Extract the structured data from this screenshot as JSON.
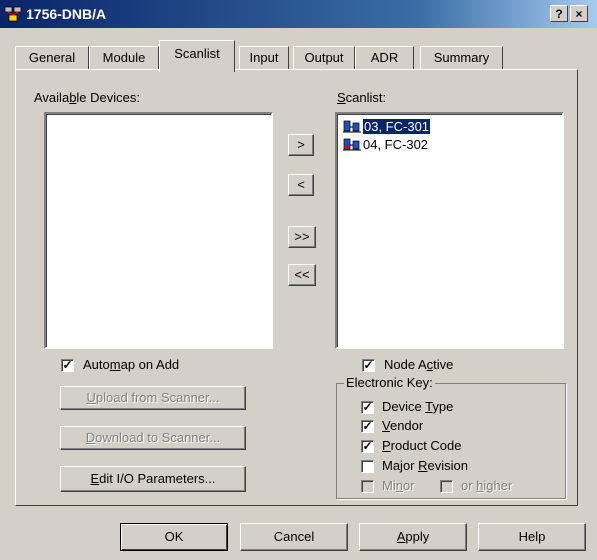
{
  "window": {
    "title": "1756-DNB/A",
    "help_label": "?",
    "close_label": "×"
  },
  "tabs": [
    "General",
    "Module",
    "Scanlist",
    "Input",
    "Output",
    "ADR",
    "Summary"
  ],
  "active_tab": "Scanlist",
  "available_devices": {
    "label_pre": "Availa",
    "label_u": "b",
    "label_post": "le Devices:",
    "items": []
  },
  "scanlist": {
    "label_u": "S",
    "label_post": "canlist:",
    "items": [
      {
        "label": "03, FC-301",
        "selected": true
      },
      {
        "label": "04, FC-302",
        "selected": false
      }
    ]
  },
  "transfer_buttons": {
    "add_one": ">",
    "remove_one": "<",
    "add_all": ">>",
    "remove_all": "<<"
  },
  "automap": {
    "pre": "Auto",
    "u": "m",
    "post": "ap on Add",
    "checked": true
  },
  "upload": {
    "u": "U",
    "post": "pload from Scanner..."
  },
  "download": {
    "u": "D",
    "post": "ownload to Scanner..."
  },
  "edit_io": {
    "u": "E",
    "post": "dit I/O Parameters..."
  },
  "node_active": {
    "pre": "Node A",
    "u": "c",
    "post": "tive",
    "checked": true
  },
  "electronic_key": {
    "title": "Electronic Key:",
    "device_type": {
      "pre": "Device ",
      "u": "T",
      "post": "ype",
      "checked": true
    },
    "vendor": {
      "u": "V",
      "post": "endor",
      "checked": true
    },
    "product_code": {
      "u": "P",
      "post": "roduct Code",
      "checked": true
    },
    "major_revision": {
      "pre": "Major ",
      "u": "R",
      "post": "evision",
      "checked": false
    },
    "minor": {
      "pre": "Mi",
      "u": "n",
      "post": "or",
      "checked": false
    },
    "or_higher": {
      "pre": "or ",
      "u": "h",
      "post": "igher",
      "checked": false
    }
  },
  "footer": {
    "ok": "OK",
    "cancel": "Cancel",
    "apply_u": "A",
    "apply_post": "pply",
    "help": "Help"
  }
}
